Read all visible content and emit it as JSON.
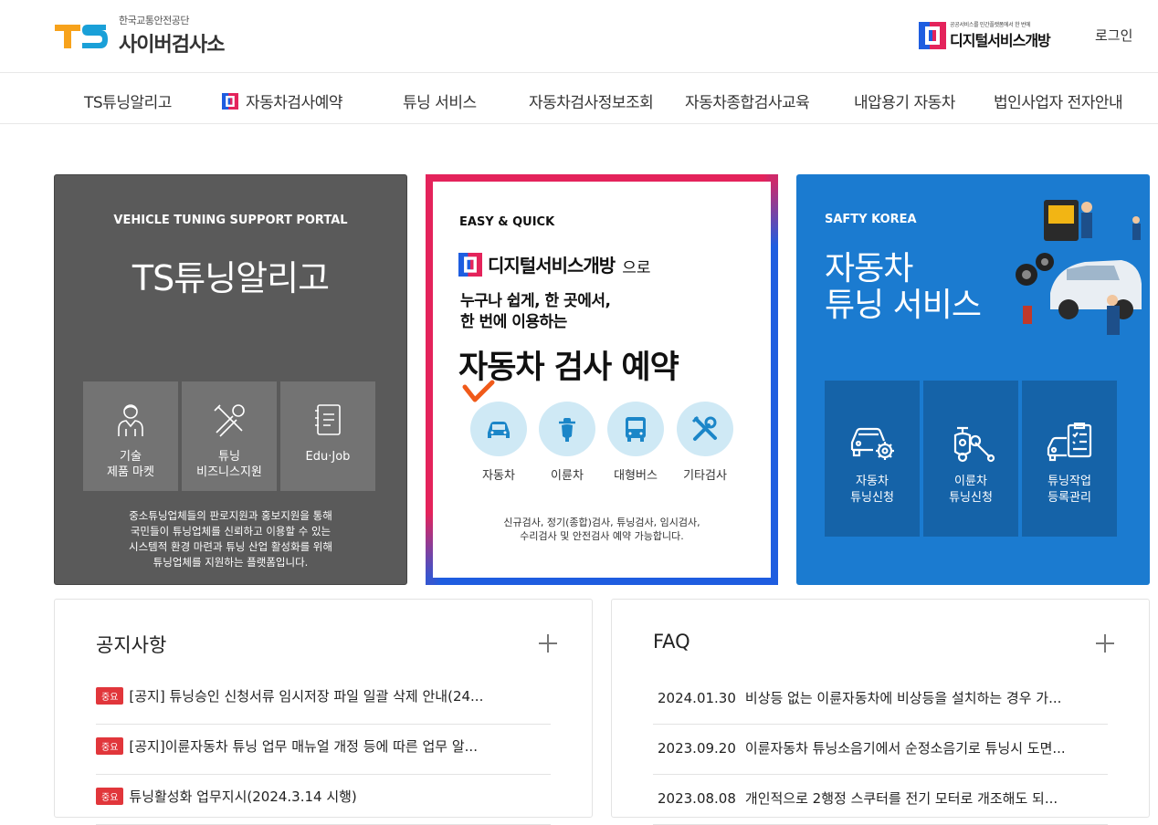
{
  "header": {
    "org_small": "한국교통안전공단",
    "site_name": "사이버검사소",
    "digital_small": "공공서비스를 민간플랫폼에서 한 번에",
    "digital_name": "디지털서비스개방",
    "login": "로그인",
    "brand_colors": {
      "ts_orange": "#f7a21b",
      "ts_blue": "#1aa0d8",
      "digital_red": "#e4235b",
      "digital_blue": "#1e5de0"
    }
  },
  "nav": [
    {
      "label": "TS튜닝알리고"
    },
    {
      "label": "자동차검사예약",
      "icon": "digital-service-icon"
    },
    {
      "label": "튜닝 서비스"
    },
    {
      "label": "자동차검사정보조회"
    },
    {
      "label": "자동차종합검사교육"
    },
    {
      "label": "내압용기 자동차"
    },
    {
      "label": "법인사업자 전자안내"
    }
  ],
  "card_tuning": {
    "tag": "VEHICLE TUNING SUPPORT PORTAL",
    "title": "TS튜닝알리고",
    "tiles": [
      {
        "line1": "기술",
        "line2": "제품 마켓",
        "icon": "mechanic-icon"
      },
      {
        "line1": "튜닝",
        "line2": "비즈니스지원",
        "icon": "tools-icon"
      },
      {
        "line1": "Edu·Job",
        "line2": "",
        "icon": "document-icon"
      }
    ],
    "desc": [
      "중소튜닝업체들의 판로지원과 홍보지원을 통해",
      "국민들이 튜닝업체를 신뢰하고 이용할 수 있는",
      "시스템적 환경 마련과 튜닝 산업 활성화를 위해",
      "튜닝업체를 지원하는 플랫폼입니다."
    ]
  },
  "card_booking": {
    "tag": "EASY & QUICK",
    "digital_name": "디지털서비스개방",
    "suffix": "으로",
    "line1": "누구나 쉽게, 한 곳에서,",
    "line2": "한 번에 이용하는",
    "big": "자동차 검사 예약",
    "options": [
      {
        "label": "자동차",
        "icon": "car-icon"
      },
      {
        "label": "이륜차",
        "icon": "motorcycle-icon"
      },
      {
        "label": "대형버스",
        "icon": "bus-icon"
      },
      {
        "label": "기타검사",
        "icon": "wrench-icon"
      }
    ],
    "desc": [
      "신규검사, 정기(종합)검사, 튜닝검사, 임시검사,",
      "수리검사 및 안전검사 예약 가능합니다."
    ]
  },
  "card_service": {
    "tag": "SAFTY KOREA",
    "title1": "자동차",
    "title2": "튜닝 서비스",
    "tiles": [
      {
        "line1": "자동차",
        "line2": "튜닝신청",
        "icon": "car-gear-icon"
      },
      {
        "line1": "이륜차",
        "line2": "튜닝신청",
        "icon": "scooter-wrench-icon"
      },
      {
        "line1": "튜닝작업",
        "line2": "등록관리",
        "icon": "car-checklist-icon"
      }
    ]
  },
  "notice": {
    "title": "공지사항",
    "badge": "중요",
    "items": [
      "[공지] 튜닝승인 신청서류 임시저장 파일 일괄 삭제 안내(24...",
      "[공지]이륜자동차 튜닝 업무 매뉴얼 개정 등에 따른 업무 알...",
      "튜닝활성화 업무지시(2024.3.14 시행)"
    ]
  },
  "faq": {
    "title": "FAQ",
    "items": [
      {
        "date": "2024.01.30",
        "text": "비상등 없는 이륜자동차에 비상등을 설치하는 경우 가..."
      },
      {
        "date": "2023.09.20",
        "text": "이륜자동차 튜닝소음기에서 순정소음기로 튜닝시 도면..."
      },
      {
        "date": "2023.08.08",
        "text": "개인적으로 2행정 스쿠터를 전기 모터로 개조해도 되..."
      }
    ]
  }
}
